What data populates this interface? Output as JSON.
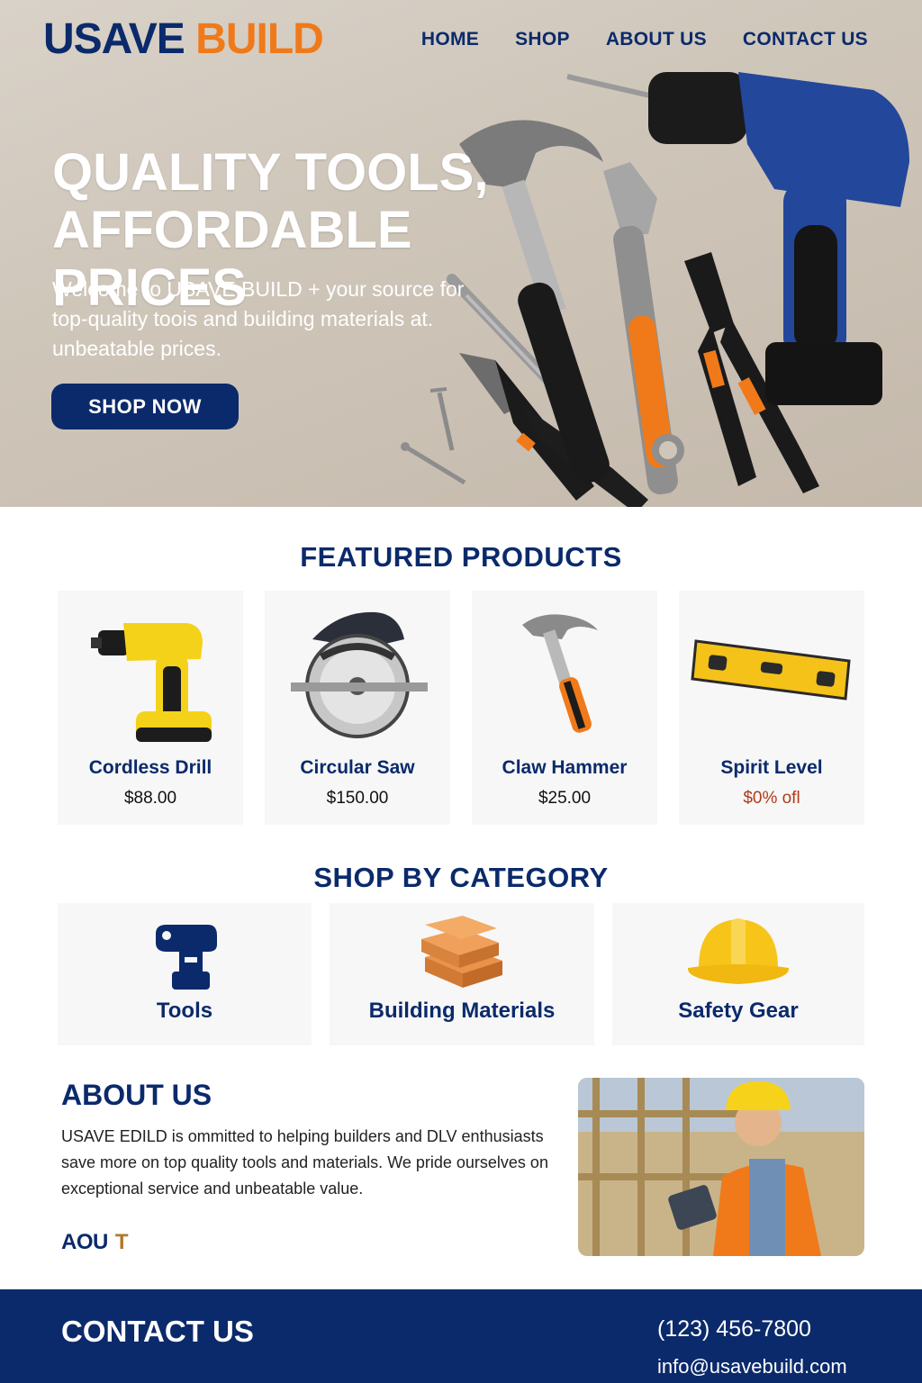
{
  "brand": {
    "part1": "USAVE",
    "part2": "BUILD",
    "primary_color": "#0b2a6b",
    "accent_color": "#f07a1a"
  },
  "nav": {
    "items": [
      "HOME",
      "SHOP",
      "ABOUT US",
      "CONTACT US"
    ]
  },
  "hero": {
    "title_line1": "QUALITY TOOLS,",
    "title_line2": "AFFORDABLE PRICES",
    "subtitle": "Welcome to USAVE BUILD + your source for top-quality toois and building materials at. unbeatable prices.",
    "cta": "SHOP NOW"
  },
  "featured": {
    "title": "FEATURED PRODUCTS",
    "products": [
      {
        "name": "Cordless Drill",
        "price": "$88.00",
        "icon": "cordless-drill-icon"
      },
      {
        "name": "Circular Saw",
        "price": "$150.00",
        "icon": "circular-saw-icon"
      },
      {
        "name": "Claw Hammer",
        "price": "$25.00",
        "icon": "claw-hammer-icon"
      },
      {
        "name": "Spirit Level",
        "price": "$0% ofl",
        "icon": "spirit-level-icon"
      }
    ]
  },
  "categories": {
    "title": "SHOP BY CATEGORY",
    "items": [
      {
        "name": "Tools",
        "icon": "drill-icon"
      },
      {
        "name": "Building Materials",
        "icon": "lumber-icon"
      },
      {
        "name": "Safety Gear",
        "icon": "hard-hat-icon"
      }
    ]
  },
  "about": {
    "title": "ABOUT US",
    "text": "USAVE EDILD is ommitted to helping builders and DLV enthusiasts save more on top quality tools and materials. We pride ourselves on exceptional service and unbeatable value.",
    "mark_left": "AOU",
    "mark_right": "T"
  },
  "contact": {
    "title": "CONTACT US",
    "phone": "(123) 456-7800",
    "email": "info@usavebuild.com"
  }
}
